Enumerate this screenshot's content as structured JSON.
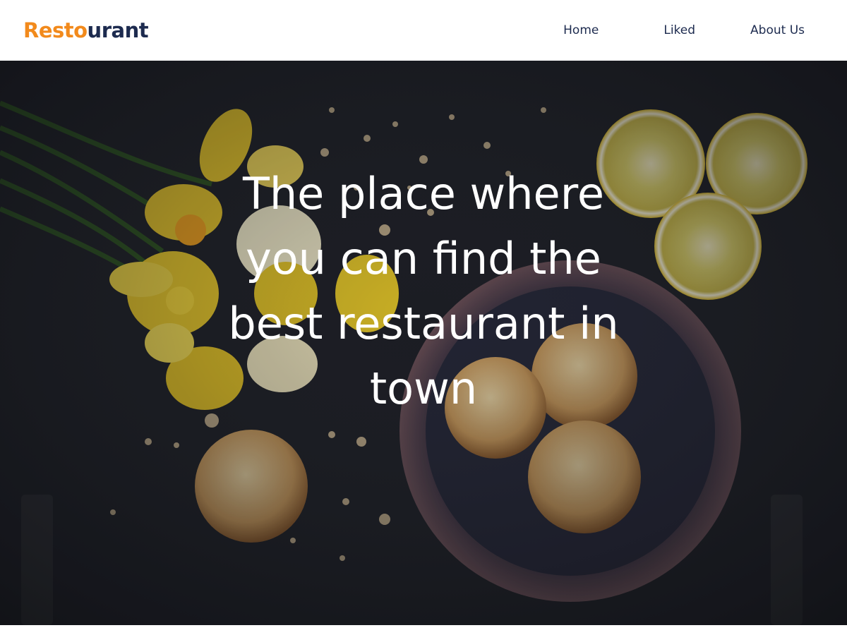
{
  "brand": {
    "part1": "Resto",
    "part2": "urant"
  },
  "nav": {
    "home": "Home",
    "liked": "Liked",
    "about": "About Us"
  },
  "hero": {
    "title": "The place where you can find the best restaurant in town"
  },
  "colors": {
    "accent": "#f28a1c",
    "navy": "#1d2b4f",
    "hero_bg": "#1e2026"
  },
  "icons": [
    "daffodil-bouquet-image",
    "lemon-slice-image",
    "cookie-image",
    "bowl-image"
  ]
}
